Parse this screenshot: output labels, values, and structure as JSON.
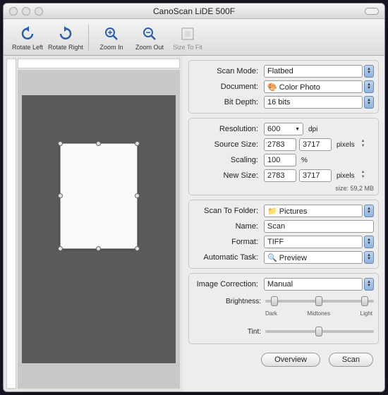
{
  "title": "CanoScan LiDE 500F",
  "toolbar": {
    "rotate_left": "Rotate Left",
    "rotate_right": "Rotate Right",
    "zoom_in": "Zoom In",
    "zoom_out": "Zoom Out",
    "size_to_fit": "Size To Fit"
  },
  "g1": {
    "scan_mode_lbl": "Scan Mode:",
    "scan_mode": "Flatbed",
    "document_lbl": "Document:",
    "document": "Color Photo",
    "bit_depth_lbl": "Bit Depth:",
    "bit_depth": "16 bits"
  },
  "g2": {
    "resolution_lbl": "Resolution:",
    "resolution": "600",
    "dpi": "dpi",
    "source_size_lbl": "Source Size:",
    "src_w": "2783",
    "src_h": "3717",
    "pixels": "pixels",
    "scaling_lbl": "Scaling:",
    "scaling": "100",
    "pct": "%",
    "new_size_lbl": "New Size:",
    "new_w": "2783",
    "new_h": "3717",
    "size_note": "size: 59,2 MB"
  },
  "g3": {
    "folder_lbl": "Scan To Folder:",
    "folder": "Pictures",
    "name_lbl": "Name:",
    "name": "Scan",
    "format_lbl": "Format:",
    "format": "TIFF",
    "task_lbl": "Automatic Task:",
    "task": "Preview"
  },
  "g4": {
    "correction_lbl": "Image Correction:",
    "correction": "Manual",
    "brightness_lbl": "Brightness:",
    "tick_dark": "Dark",
    "tick_mid": "Midtones",
    "tick_light": "Light",
    "tint_lbl": "Tint:"
  },
  "buttons": {
    "overview": "Overview",
    "scan": "Scan"
  }
}
